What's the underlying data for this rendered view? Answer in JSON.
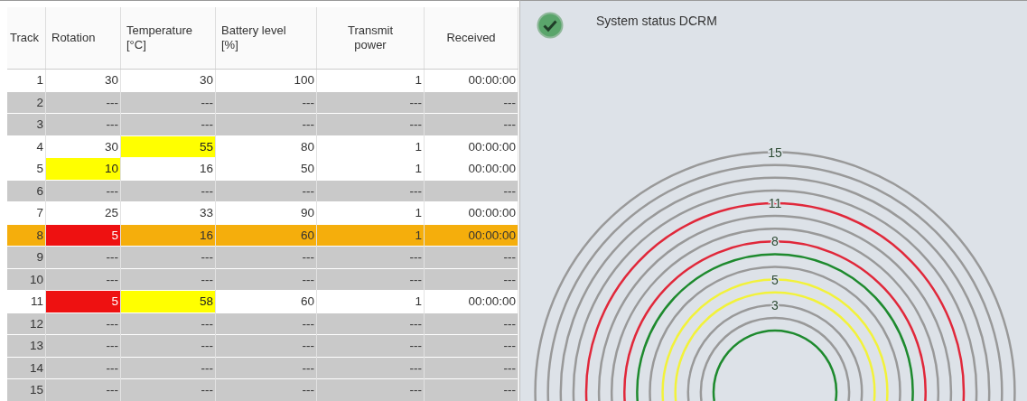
{
  "table": {
    "columns": [
      "Track",
      "Rotation",
      "Temperature\n[°C]",
      "Battery level\n[%]",
      "Transmit\npower",
      "Received"
    ],
    "rows": [
      {
        "color": "#ffffff",
        "cells": [
          {
            "text": "1"
          },
          {
            "text": "30"
          },
          {
            "text": "30"
          },
          {
            "text": "100"
          },
          {
            "text": "1"
          },
          {
            "text": "00:00:00"
          }
        ]
      },
      {
        "color": "#c9c9c9",
        "cells": [
          {
            "text": "2"
          },
          {
            "text": "---"
          },
          {
            "text": "---"
          },
          {
            "text": "---"
          },
          {
            "text": "---"
          },
          {
            "text": "---"
          }
        ]
      },
      {
        "color": "#c9c9c9",
        "cells": [
          {
            "text": "3"
          },
          {
            "text": "---"
          },
          {
            "text": "---"
          },
          {
            "text": "---"
          },
          {
            "text": "---"
          },
          {
            "text": "---"
          }
        ]
      },
      {
        "color": "#ffffff",
        "cells": [
          {
            "text": "4"
          },
          {
            "text": "30"
          },
          {
            "text": "55",
            "color": "#ffff00"
          },
          {
            "text": "80"
          },
          {
            "text": "1"
          },
          {
            "text": "00:00:00"
          }
        ]
      },
      {
        "color": "#ffffff",
        "cells": [
          {
            "text": "5"
          },
          {
            "text": "10",
            "color": "#ffff00"
          },
          {
            "text": "16"
          },
          {
            "text": "50"
          },
          {
            "text": "1"
          },
          {
            "text": "00:00:00"
          }
        ]
      },
      {
        "color": "#c9c9c9",
        "cells": [
          {
            "text": "6"
          },
          {
            "text": "---"
          },
          {
            "text": "---"
          },
          {
            "text": "---"
          },
          {
            "text": "---"
          },
          {
            "text": "---"
          }
        ]
      },
      {
        "color": "#ffffff",
        "cells": [
          {
            "text": "7"
          },
          {
            "text": "25"
          },
          {
            "text": "33"
          },
          {
            "text": "90"
          },
          {
            "text": "1"
          },
          {
            "text": "00:00:00"
          }
        ]
      },
      {
        "color": "#f5ae0c",
        "cells": [
          {
            "text": "8"
          },
          {
            "text": "5",
            "color": "#ee1111"
          },
          {
            "text": "16"
          },
          {
            "text": "60"
          },
          {
            "text": "1"
          },
          {
            "text": "00:00:00"
          }
        ]
      },
      {
        "color": "#c9c9c9",
        "cells": [
          {
            "text": "9"
          },
          {
            "text": "---"
          },
          {
            "text": "---"
          },
          {
            "text": "---"
          },
          {
            "text": "---"
          },
          {
            "text": "---"
          }
        ]
      },
      {
        "color": "#c9c9c9",
        "cells": [
          {
            "text": "10"
          },
          {
            "text": "---"
          },
          {
            "text": "---"
          },
          {
            "text": "---"
          },
          {
            "text": "---"
          },
          {
            "text": "---"
          }
        ]
      },
      {
        "color": "#ffffff",
        "cells": [
          {
            "text": "11"
          },
          {
            "text": "5",
            "color": "#ee1111"
          },
          {
            "text": "58",
            "color": "#ffff00"
          },
          {
            "text": "60"
          },
          {
            "text": "1"
          },
          {
            "text": "00:00:00"
          }
        ]
      },
      {
        "color": "#c9c9c9",
        "cells": [
          {
            "text": "12"
          },
          {
            "text": "---"
          },
          {
            "text": "---"
          },
          {
            "text": "---"
          },
          {
            "text": "---"
          },
          {
            "text": "---"
          }
        ]
      },
      {
        "color": "#c9c9c9",
        "cells": [
          {
            "text": "13"
          },
          {
            "text": "---"
          },
          {
            "text": "---"
          },
          {
            "text": "---"
          },
          {
            "text": "---"
          },
          {
            "text": "---"
          }
        ]
      },
      {
        "color": "#c9c9c9",
        "cells": [
          {
            "text": "14"
          },
          {
            "text": "---"
          },
          {
            "text": "---"
          },
          {
            "text": "---"
          },
          {
            "text": "---"
          },
          {
            "text": "---"
          }
        ]
      },
      {
        "color": "#c9c9c9",
        "cells": [
          {
            "text": "15"
          },
          {
            "text": "---"
          },
          {
            "text": "---"
          },
          {
            "text": "---"
          },
          {
            "text": "---"
          },
          {
            "text": "---"
          }
        ]
      }
    ]
  },
  "status_panel": {
    "ok": true,
    "title": "System status DCRM",
    "ring_labels": [
      "15",
      "11",
      "8",
      "5",
      "3"
    ]
  }
}
